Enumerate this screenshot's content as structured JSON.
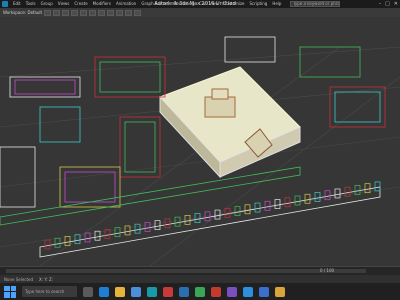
{
  "window": {
    "title": "Autodesk 3ds Max 2016   Untitled",
    "search_placeholder": "Type a keyword or phrase",
    "workspace_label": "Workspace: Default"
  },
  "menu": [
    "Edit",
    "Tools",
    "Group",
    "Views",
    "Create",
    "Modifiers",
    "Animation",
    "Graph Editors",
    "Rendering",
    "Civil View",
    "Customize",
    "Scripting",
    "Help"
  ],
  "window_controls": [
    "–",
    "□",
    "✕"
  ],
  "toolbar": {
    "tool_icons": [
      "undo-icon",
      "redo-icon",
      "link-icon",
      "select-icon",
      "move-icon",
      "rotate-icon",
      "scale-icon",
      "snap-icon",
      "mirror-icon",
      "align-icon",
      "render-icon"
    ]
  },
  "timeline": {
    "frame_counter": "0 / 100"
  },
  "status": {
    "text": "None Selected",
    "coords": "X:   Y:   Z:"
  },
  "taskbar": {
    "search_placeholder": "Type here to search",
    "apps": [
      {
        "name": "task-view-icon",
        "color": "#5a5a5a"
      },
      {
        "name": "edge-icon",
        "color": "#1f7fd6"
      },
      {
        "name": "explorer-icon",
        "color": "#e8b33a"
      },
      {
        "name": "store-icon",
        "color": "#4b8fd8"
      },
      {
        "name": "3dsmax-icon",
        "color": "#1a9aa8"
      },
      {
        "name": "autocad-icon",
        "color": "#c83a3a"
      },
      {
        "name": "photoshop-icon",
        "color": "#2c6fb0"
      },
      {
        "name": "chrome-icon",
        "color": "#3aa655"
      },
      {
        "name": "acrobat-icon",
        "color": "#c43b2e"
      },
      {
        "name": "media-icon",
        "color": "#7a4fc2"
      },
      {
        "name": "skype-icon",
        "color": "#2d8fe0"
      },
      {
        "name": "mail-icon",
        "color": "#3b6fcf"
      },
      {
        "name": "folder-icon",
        "color": "#d9a53a"
      }
    ],
    "clock_time": "",
    "clock_date": ""
  },
  "colors": {
    "viewport_bg": "#363636",
    "wire_red": "#c8323c",
    "wire_green": "#3fbf5a",
    "wire_white": "#e8e8e8",
    "wire_yellow": "#d6c84a",
    "wire_cyan": "#3fc9c9",
    "wire_magenta": "#c84ad1"
  }
}
